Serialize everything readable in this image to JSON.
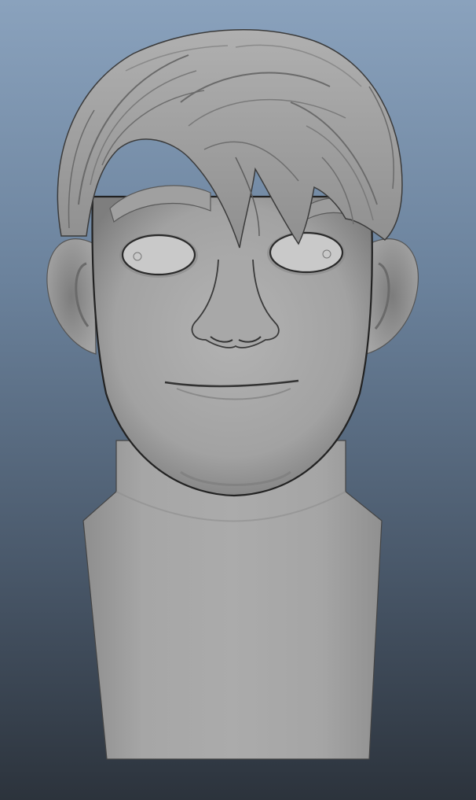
{
  "viewport": {
    "background_top": "#8aa2bd",
    "background_bottom": "#2c333c"
  },
  "model": {
    "subject": "grey-shaded-3d-bust",
    "skin_color": "#a9a9a9",
    "shadow_color": "#6e6e6e",
    "hair_color": "#9c9c9c",
    "line_color": "#2a2a2a"
  }
}
